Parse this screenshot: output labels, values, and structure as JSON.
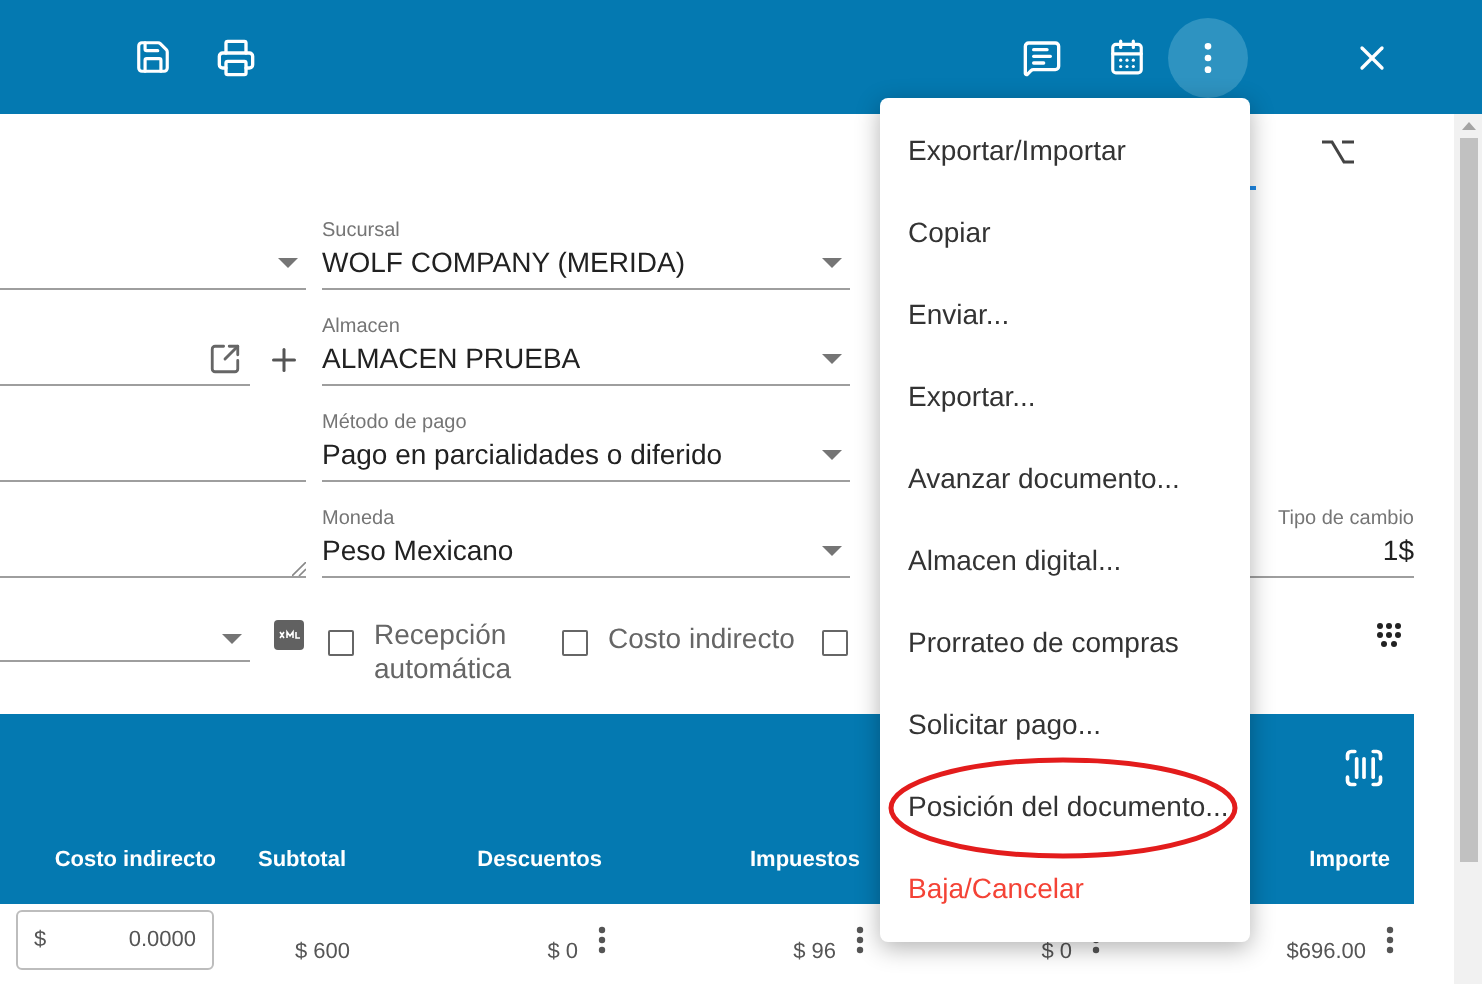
{
  "left_fields": [
    {
      "kind": "select"
    },
    {
      "kind": "link"
    },
    {
      "kind": "text"
    },
    {
      "kind": "textarea"
    }
  ],
  "right_fields": [
    {
      "label": "Sucursal",
      "value": "WOLF COMPANY (MERIDA)"
    },
    {
      "label": "Almacen",
      "value": "ALMACEN PRUEBA"
    },
    {
      "label": "Método de pago",
      "value": "Pago en parcialidades o diferido"
    },
    {
      "label": "Moneda",
      "value": "Peso Mexicano"
    }
  ],
  "exchange": {
    "label": "Tipo de cambio",
    "value": "1$"
  },
  "checkboxes": [
    {
      "label": "Recepción automática",
      "checked": false
    },
    {
      "label": "Costo indirecto",
      "checked": false
    },
    {
      "checked": false
    }
  ],
  "menu": [
    {
      "label": "Exportar/Importar",
      "kind": "normal",
      "circled": false
    },
    {
      "label": "Copiar",
      "kind": "normal",
      "circled": false
    },
    {
      "label": "Enviar...",
      "kind": "normal",
      "circled": false
    },
    {
      "label": "Exportar...",
      "kind": "normal",
      "circled": false
    },
    {
      "label": "Avanzar documento...",
      "kind": "normal",
      "circled": false
    },
    {
      "label": "Almacen digital...",
      "kind": "normal",
      "circled": false
    },
    {
      "label": "Prorrateo de compras",
      "kind": "normal",
      "circled": false
    },
    {
      "label": "Solicitar pago...",
      "kind": "normal",
      "circled": false
    },
    {
      "label": "Posición del documento...",
      "kind": "normal",
      "circled": true
    },
    {
      "label": "Baja/Cancelar",
      "kind": "danger",
      "circled": false
    }
  ],
  "table": {
    "columns": [
      {
        "label": "Costo indirecto"
      },
      {
        "label": "Subtotal"
      },
      {
        "label": "Descuentos"
      },
      {
        "label": "Impuestos"
      },
      {
        "label": "Importe"
      }
    ],
    "row": [
      {
        "kind": "input",
        "prefix": "$",
        "value": "0.0000"
      },
      {
        "kind": "text",
        "value": "$ 600"
      },
      {
        "kind": "menu",
        "value": "$ 0"
      },
      {
        "kind": "menu",
        "value": "$ 96"
      },
      {
        "kind": "menu",
        "value": "$ 0"
      },
      {
        "kind": "menu",
        "value": "$696.00"
      }
    ]
  }
}
